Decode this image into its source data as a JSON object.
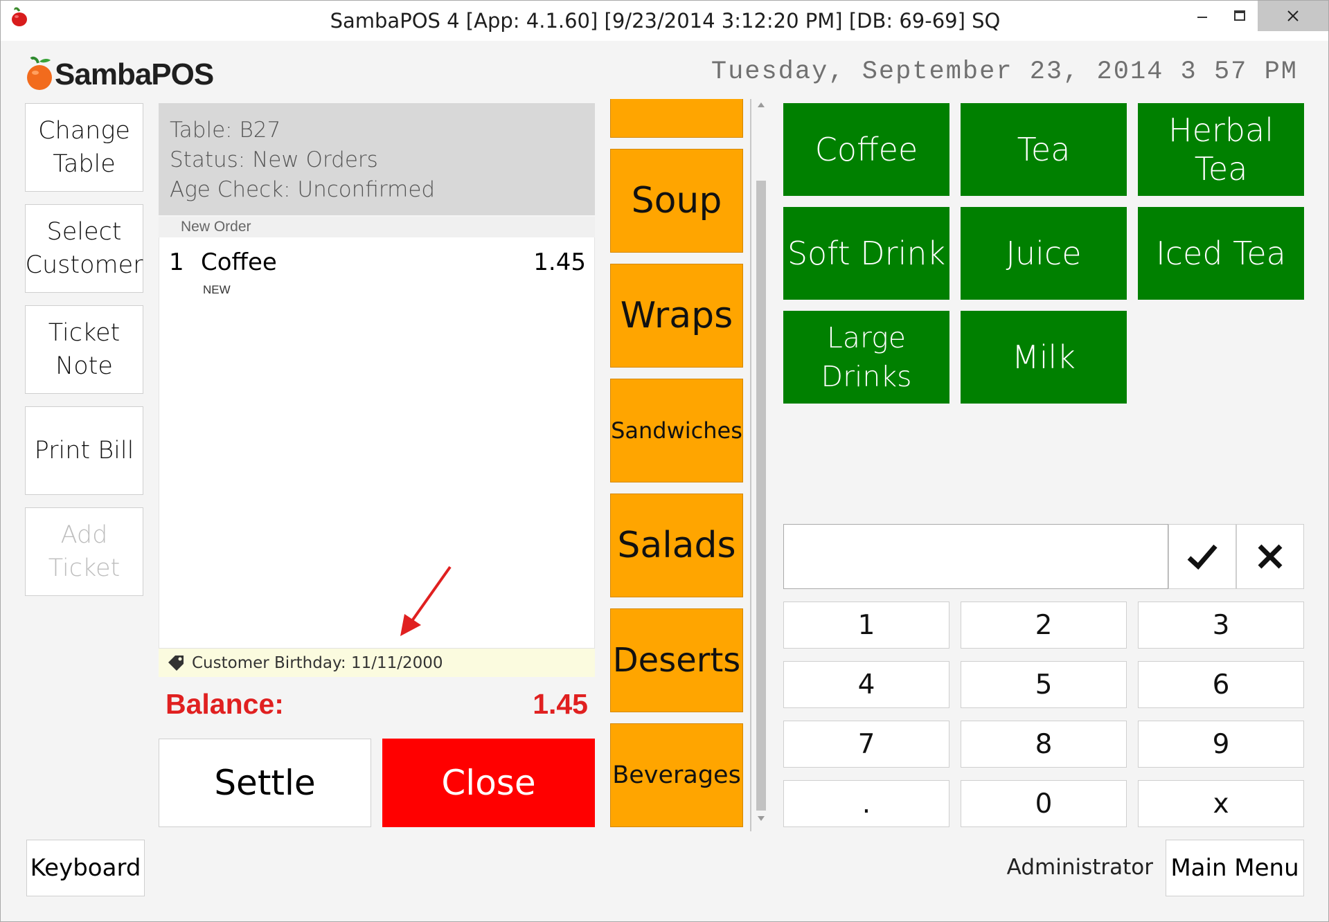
{
  "titlebar": {
    "title": "SambaPOS 4 [App: 4.1.60] [9/23/2014 3:12:20 PM] [DB: 69-69] SQ",
    "minimize_icon": "minimize-icon",
    "maximize_icon": "maximize-icon",
    "close_icon": "close-icon"
  },
  "header": {
    "logo_text": "SambaPOS",
    "datetime": "Tuesday, September 23, 2014 3 57 PM"
  },
  "ticket_commands": [
    {
      "label": "Change Table",
      "enabled": true
    },
    {
      "label": "Select Customer",
      "enabled": true
    },
    {
      "label": "Ticket Note",
      "enabled": true
    },
    {
      "label": "Print Bill",
      "enabled": true
    },
    {
      "label": "Add Ticket",
      "enabled": false
    }
  ],
  "ticket": {
    "table": "Table: B27",
    "status": "Status: New Orders",
    "age_check": "Age Check: Unconfirmed",
    "order_group": "New Order",
    "orders": [
      {
        "qty": "1",
        "name": "Coffee",
        "price": "1.45",
        "state": "NEW"
      }
    ],
    "note": "Customer Birthday: 11/11/2000",
    "note_icon": "tag-icon",
    "balance_label": "Balance:",
    "balance_value": "1.45",
    "settle_label": "Settle",
    "close_label": "Close"
  },
  "categories": [
    "",
    "Soup",
    "Wraps",
    "Sandwiches",
    "Salads",
    "Deserts",
    "Beverages"
  ],
  "menu_items": [
    "Coffee",
    "Tea",
    "Herbal Tea",
    "Soft Drink",
    "Juice",
    "Iced Tea",
    "Large Drinks",
    "Milk"
  ],
  "numpad": {
    "value": "",
    "keys": [
      "1",
      "2",
      "3",
      "4",
      "5",
      "6",
      "7",
      "8",
      "9",
      ".",
      "0",
      "x"
    ],
    "confirm_icon": "checkmark-icon",
    "cancel_icon": "x-icon"
  },
  "footer": {
    "keyboard_label": "Keyboard",
    "user": "Administrator",
    "main_menu_label": "Main Menu"
  },
  "colors": {
    "category_orange": "#FFA500",
    "menu_green": "#008000",
    "close_red": "#FF0000",
    "balance_red": "#E02020",
    "arrow_red": "#E02020"
  }
}
